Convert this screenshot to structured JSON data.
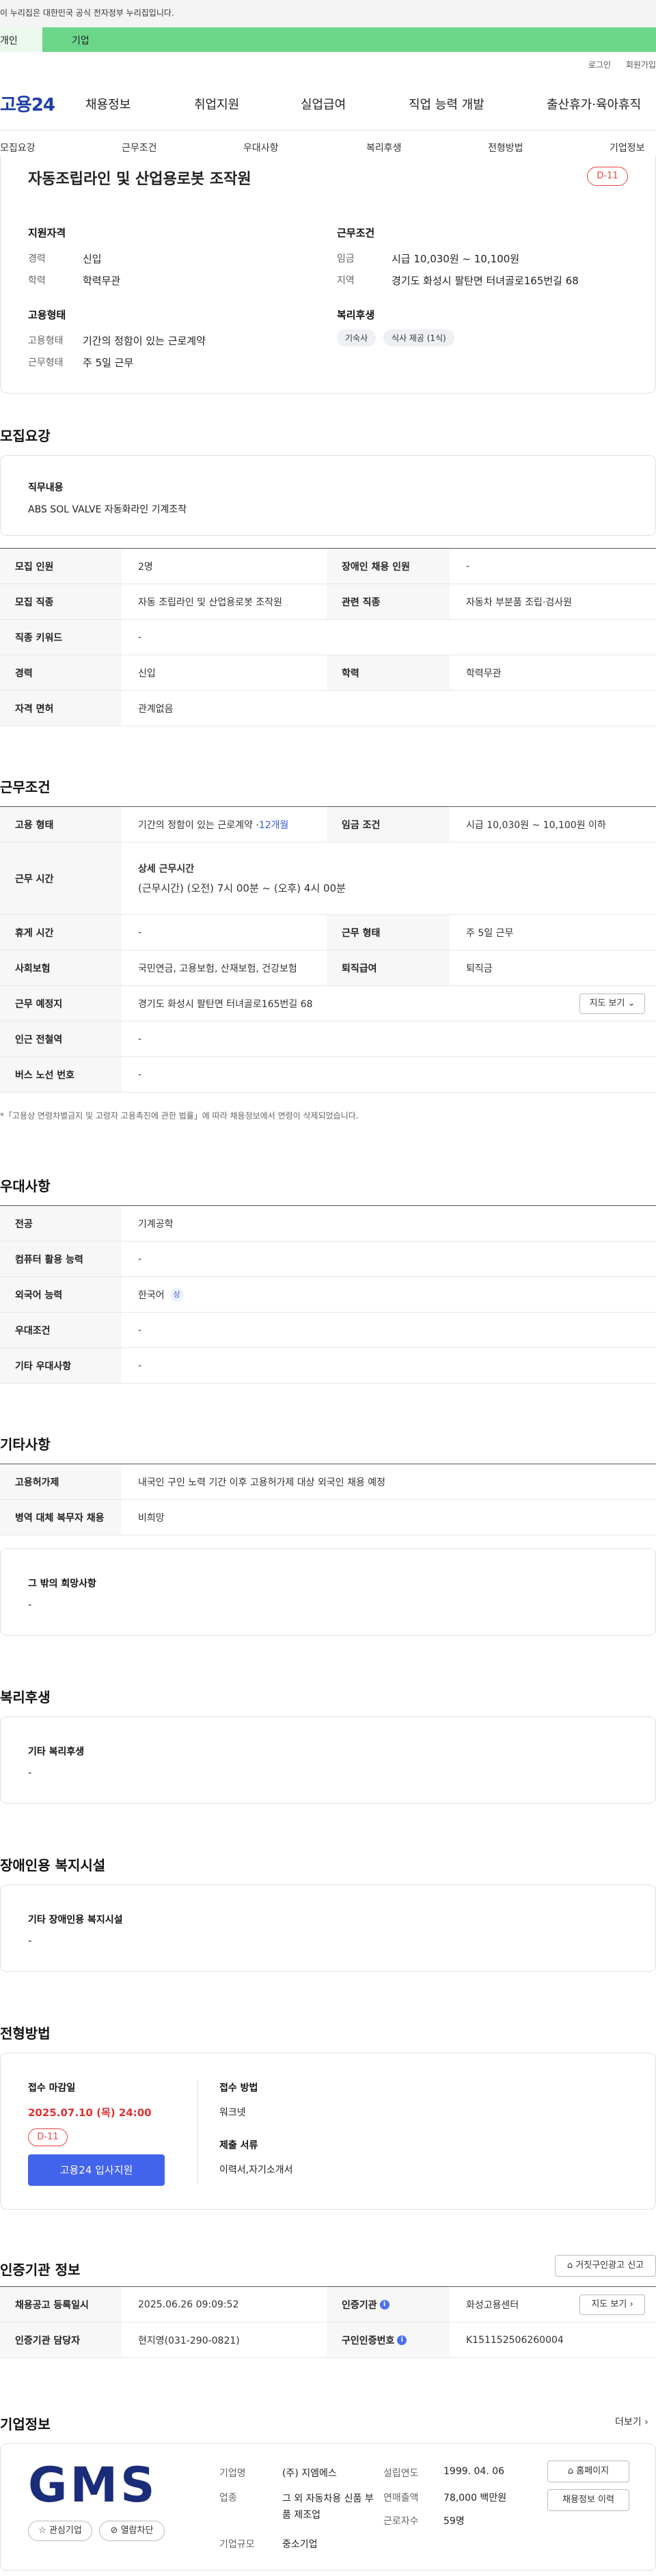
{
  "top": {
    "gov_notice": "이 누리집은 대한민국 공식 전자정부 누리집입니다.",
    "tab_person": "개인",
    "tab_biz": "기업",
    "login": "로그인",
    "join": "회원가입"
  },
  "nav": {
    "logo": "고용24",
    "items": [
      "채용정보",
      "취업지원",
      "실업급여",
      "직업 능력 개발",
      "출산휴가·육아휴직"
    ]
  },
  "subnav": [
    "모집요강",
    "근무조건",
    "우대사항",
    "복리후생",
    "전형방법",
    "기업정보"
  ],
  "summary": {
    "title": "자동조립라인 및 산업용로봇 조작원",
    "dday": "D-11",
    "qual_title": "지원자격",
    "career_label": "경력",
    "career_value": "신입",
    "edu_label": "학력",
    "edu_value": "학력무관",
    "cond_title": "근무조건",
    "wage_label": "임금",
    "wage_value": "시급 10,030원 ~ 10,100원",
    "area_label": "지역",
    "area_value": "경기도 화성시 팔탄면 터녀골로165번길 68",
    "emp_title": "고용형태",
    "emptype_label": "고용형태",
    "emptype_value": "기간의 정함이 있는 근로계약",
    "workform_label": "근무형태",
    "workform_value": "주 5일 근무",
    "welfare_title": "복리후생",
    "welfare_chips": [
      "기숙사",
      "식사 제공 (1식)"
    ]
  },
  "recruit": {
    "title": "모집요강",
    "duty_label": "직무내용",
    "duty_value": "ABS SOL VALVE 자동화라인 기계조작",
    "rows": [
      {
        "k1": "모집 인원",
        "v1": "2명",
        "k2": "장애인 채용 인원",
        "v2": "-"
      },
      {
        "k1": "모집 직종",
        "v1": "자동 조립라인 및 산업용로봇 조작원",
        "k2": "관련 직종",
        "v2": "자동차 부분품 조립·검사원"
      },
      {
        "k1": "직종 키워드",
        "v1": "-",
        "k2": "",
        "v2": ""
      },
      {
        "k1": "경력",
        "v1": "신입",
        "k2": "학력",
        "v2": "학력무관"
      },
      {
        "k1": "자격 면허",
        "v1": "관계없음",
        "k2": "",
        "v2": ""
      }
    ]
  },
  "work": {
    "title": "근무조건",
    "emptype_label": "고용 형태",
    "emptype_value": "기간의 정함이 있는 근로계약 · ",
    "emptype_months": "12개월",
    "wagecond_label": "임금 조건",
    "wagecond_value": "시급 10,030원 ~ 10,100원 이하",
    "hours_label": "근무 시간",
    "hours_sub": "상세 근무시간",
    "hours_value": "(근무시간) (오전) 7시 00분 ~ (오후) 4시 00분",
    "rest_label": "휴게 시간",
    "rest_value": "-",
    "form_label": "근무 형태",
    "form_value": "주 5일 근무",
    "insure_label": "사회보험",
    "insure_value": "국민연금, 고용보험, 산재보험, 건강보험",
    "severance_label": "퇴직급여",
    "severance_value": "퇴직금",
    "place_label": "근무 예정지",
    "place_value": "경기도 화성시 팔탄면 터녀골로165번길 68",
    "map_btn": "지도 보기",
    "subway_label": "인근 전철역",
    "subway_value": "-",
    "bus_label": "버스 노선 번호",
    "bus_value": "-",
    "note": "*「고용상 연령차별금지 및 고령자 고용촉진에 관한 법률」에 따라 채용정보에서 연령이 삭제되었습니다."
  },
  "prefer": {
    "title": "우대사항",
    "rows": [
      {
        "k": "전공",
        "v": "기계공학"
      },
      {
        "k": "컴퓨터 활용 능력",
        "v": "-"
      },
      {
        "k": "외국어 능력",
        "v": "한국어",
        "tag": "상"
      },
      {
        "k": "우대조건",
        "v": "-"
      },
      {
        "k": "기타 우대사항",
        "v": "-"
      }
    ]
  },
  "etc": {
    "title": "기타사항",
    "rows": [
      {
        "k": "고용허가제",
        "v": "내국인 구인 노력 기간 이후 고용허가제 대상 외국인 채용 예정"
      },
      {
        "k": "병역 대체 복무자 채용",
        "v": "비희망"
      }
    ],
    "box_label": "그 밖의 희망사항",
    "box_value": "-"
  },
  "welfare": {
    "title": "복리후생",
    "box_label": "기타 복리후생",
    "box_value": "-"
  },
  "disabled": {
    "title": "장애인용 복지시설",
    "box_label": "기타 장애인용 복지시설",
    "box_value": "-"
  },
  "selection": {
    "title": "전형방법",
    "deadline_label": "접수 마감일",
    "deadline_value": "2025.07.10 (목) 24:00",
    "dday": "D-11",
    "apply_btn": "고용24 입사지원",
    "method_label": "접수 방법",
    "method_value": "워크넷",
    "docs_label": "제출 서류",
    "docs_value": "이력서,자기소개서"
  },
  "agency": {
    "title": "인증기관 정보",
    "report_btn": "거짓구인광고 신고",
    "reg_label": "채용공고 등록일시",
    "reg_value": "2025.06.26 09:09:52",
    "org_label": "인증기관",
    "org_value": "화성고용센터",
    "map_btn": "지도 보기",
    "staff_label": "인증기관 담당자",
    "staff_value": "현지영(031-290-0821)",
    "num_label": "구인인증번호",
    "num_value": "K151152506260004"
  },
  "company": {
    "title": "기업정보",
    "more": "더보기",
    "logo_text": "GMS",
    "fav_btn": "관심기업",
    "block_btn": "열람차단",
    "name_label": "기업명",
    "name_value": "(주) 지엠에스",
    "industry_label": "업종",
    "industry_value": "그 외 자동차용 신품 부품 제조업",
    "size_label": "기업규모",
    "size_value": "중소기업",
    "founded_label": "설립연도",
    "founded_value": "1999. 04. 06",
    "sales_label": "연매출액",
    "sales_value": "78,000 백만원",
    "emp_label": "근로자수",
    "emp_value": "59명",
    "home_btn": "홈페이지",
    "jobs_btn": "채용정보 이력"
  }
}
